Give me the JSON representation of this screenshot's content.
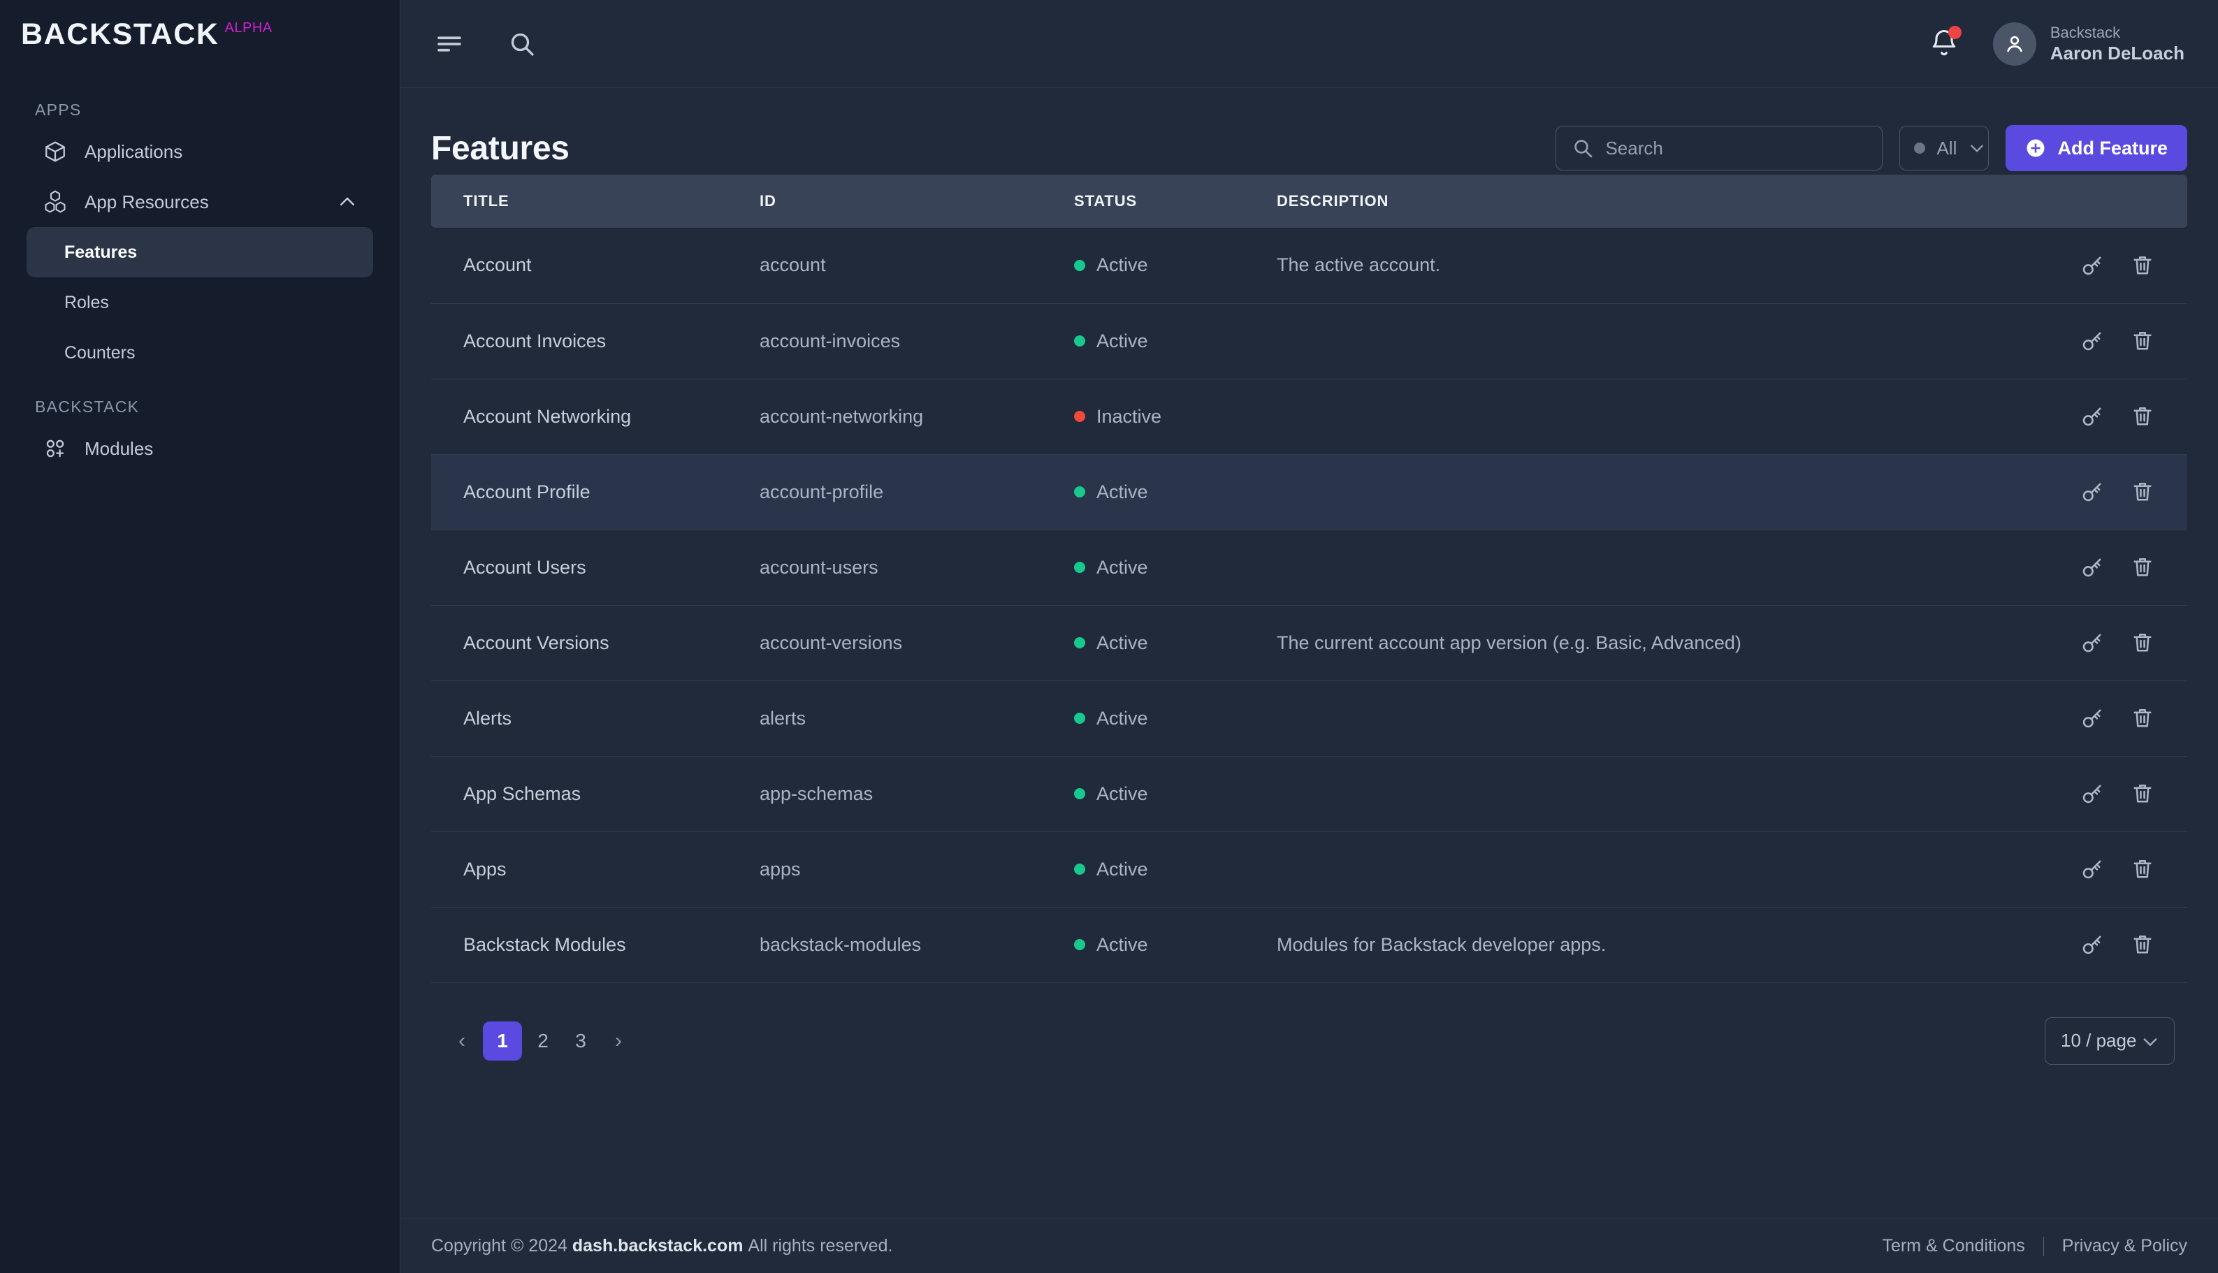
{
  "brand": {
    "name": "BACKSTACK",
    "tag": "ALPHA"
  },
  "sidebar": {
    "sections": [
      {
        "label": "APPS"
      },
      {
        "label": "BACKSTACK"
      }
    ],
    "apps_items": [
      {
        "label": "Applications",
        "icon": "cube-icon"
      },
      {
        "label": "App Resources",
        "icon": "stacked-cubes-icon"
      }
    ],
    "sub_items": [
      {
        "label": "Features",
        "active": true
      },
      {
        "label": "Roles",
        "active": false
      },
      {
        "label": "Counters",
        "active": false
      }
    ],
    "backstack_items": [
      {
        "label": "Modules",
        "icon": "modules-grid-icon"
      }
    ]
  },
  "topbar": {
    "menu_icon": "hamburger-icon",
    "search_icon": "search-icon",
    "bell_icon": "bell-icon",
    "user": {
      "org": "Backstack",
      "name": "Aaron DeLoach"
    }
  },
  "page": {
    "title": "Features"
  },
  "toolbar": {
    "search": {
      "value": "",
      "placeholder": "Search"
    },
    "filter": {
      "selected": "All"
    },
    "add_button": "Add Feature"
  },
  "table": {
    "headers": [
      "TITLE",
      "ID",
      "STATUS",
      "DESCRIPTION"
    ],
    "rows": [
      {
        "title": "Account",
        "id": "account",
        "status": "Active",
        "description": "The active account.",
        "highlight": false
      },
      {
        "title": "Account Invoices",
        "id": "account-invoices",
        "status": "Active",
        "description": "",
        "highlight": false
      },
      {
        "title": "Account Networking",
        "id": "account-networking",
        "status": "Inactive",
        "description": "",
        "highlight": false
      },
      {
        "title": "Account Profile",
        "id": "account-profile",
        "status": "Active",
        "description": "",
        "highlight": true
      },
      {
        "title": "Account Users",
        "id": "account-users",
        "status": "Active",
        "description": "",
        "highlight": false
      },
      {
        "title": "Account Versions",
        "id": "account-versions",
        "status": "Active",
        "description": "The current account app version (e.g. Basic, Advanced)",
        "highlight": false
      },
      {
        "title": "Alerts",
        "id": "alerts",
        "status": "Active",
        "description": "",
        "highlight": false
      },
      {
        "title": "App Schemas",
        "id": "app-schemas",
        "status": "Active",
        "description": "",
        "highlight": false
      },
      {
        "title": "Apps",
        "id": "apps",
        "status": "Active",
        "description": "",
        "highlight": false
      },
      {
        "title": "Backstack Modules",
        "id": "backstack-modules",
        "status": "Active",
        "description": "Modules for Backstack developer apps.",
        "highlight": false
      }
    ],
    "row_actions": [
      {
        "icon": "key-icon",
        "name": "permissions-action"
      },
      {
        "icon": "trash-icon",
        "name": "delete-action"
      }
    ]
  },
  "pagination": {
    "prev": "‹",
    "pages": [
      "1",
      "2",
      "3"
    ],
    "current": "1",
    "next": "›",
    "per_page": "10 / page"
  },
  "footer": {
    "copyright_prefix": "Copyright © 2024",
    "domain": "dash.backstack.com",
    "copyright_suffix": "All rights reserved.",
    "terms": "Term & Conditions",
    "privacy": "Privacy & Policy"
  },
  "colors": {
    "accent": "#5b4ae0",
    "alpha_tag": "#d41fd4",
    "active": "#18c98e",
    "inactive": "#ef4a3c",
    "notification": "#ef4444",
    "sidebar_bg": "#151c2c",
    "main_bg": "#212a3b",
    "table_head_bg": "#384357"
  }
}
